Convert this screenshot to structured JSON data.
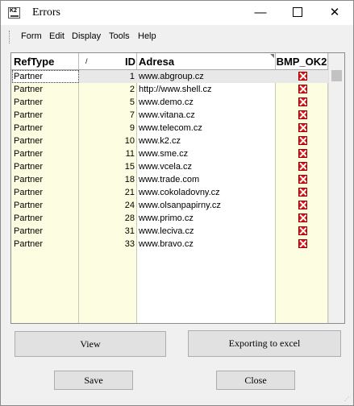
{
  "window": {
    "title": "Errors",
    "icon_text": "K2",
    "minimize_label": "—",
    "close_label": "✕"
  },
  "menu": [
    {
      "label": "Form"
    },
    {
      "label": "Edit"
    },
    {
      "label": "Display"
    },
    {
      "label": "Tools"
    },
    {
      "label": "Help"
    }
  ],
  "grid": {
    "columns": {
      "reftype": "RefType",
      "sort_mark": "/",
      "id": "ID",
      "address": "Adresa",
      "bmp": "BMP_OK2"
    },
    "rows": [
      {
        "reftype": "Partner",
        "id": "1",
        "address": "www.abgroup.cz",
        "bmp_ok": false
      },
      {
        "reftype": "Partner",
        "id": "2",
        "address": "http://www.shell.cz",
        "bmp_ok": false
      },
      {
        "reftype": "Partner",
        "id": "5",
        "address": "www.demo.cz",
        "bmp_ok": false
      },
      {
        "reftype": "Partner",
        "id": "7",
        "address": "www.vitana.cz",
        "bmp_ok": false
      },
      {
        "reftype": "Partner",
        "id": "9",
        "address": "www.telecom.cz",
        "bmp_ok": false
      },
      {
        "reftype": "Partner",
        "id": "10",
        "address": "www.k2.cz",
        "bmp_ok": false
      },
      {
        "reftype": "Partner",
        "id": "11",
        "address": "www.sme.cz",
        "bmp_ok": false
      },
      {
        "reftype": "Partner",
        "id": "15",
        "address": "www.vcela.cz",
        "bmp_ok": false
      },
      {
        "reftype": "Partner",
        "id": "18",
        "address": "www.trade.com",
        "bmp_ok": false
      },
      {
        "reftype": "Partner",
        "id": "21",
        "address": "www.cokoladovny.cz",
        "bmp_ok": false
      },
      {
        "reftype": "Partner",
        "id": "24",
        "address": "www.olsanpapirny.cz",
        "bmp_ok": false
      },
      {
        "reftype": "Partner",
        "id": "28",
        "address": "www.primo.cz",
        "bmp_ok": false
      },
      {
        "reftype": "Partner",
        "id": "31",
        "address": "www.leciva.cz",
        "bmp_ok": false
      },
      {
        "reftype": "Partner",
        "id": "33",
        "address": "www.bravo.cz",
        "bmp_ok": false
      }
    ]
  },
  "buttons": {
    "view": "View",
    "export": "Exporting to excel",
    "save": "Save",
    "close": "Close"
  },
  "colors": {
    "grid_background": "#fdfde2",
    "error_mark": "#e01414"
  }
}
